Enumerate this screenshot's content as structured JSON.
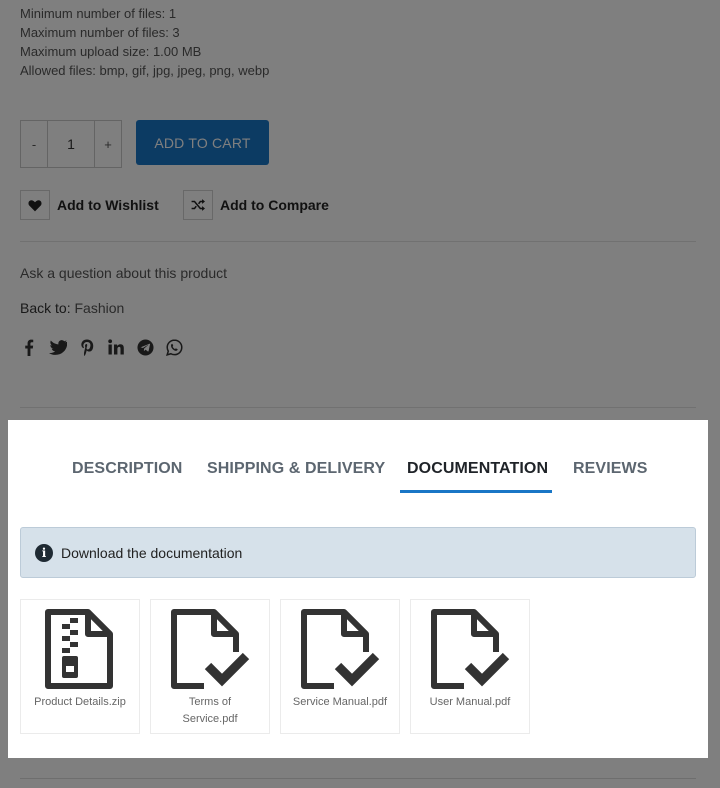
{
  "upload": {
    "min_files": "Minimum number of files: 1",
    "max_files": "Maximum number of files: 3",
    "max_size": "Maximum upload size: 1.00 MB",
    "allowed": "Allowed files: bmp, gif, jpg, jpeg, png, webp"
  },
  "quantity": {
    "minus": "-",
    "value": "1",
    "plus": "+"
  },
  "cart": {
    "add_label": "ADD TO CART"
  },
  "actions": {
    "wishlist": "Add to Wishlist",
    "compare": "Add to Compare"
  },
  "ask_question": "Ask a question about this product",
  "back": {
    "prefix": "Back to:",
    "link": "Fashion"
  },
  "social_icons": [
    "facebook-icon",
    "twitter-icon",
    "pinterest-icon",
    "linkedin-icon",
    "telegram-icon",
    "whatsapp-icon"
  ],
  "tabs": [
    {
      "label": "DESCRIPTION",
      "active": false
    },
    {
      "label": "SHIPPING & DELIVERY",
      "active": false
    },
    {
      "label": "DOCUMENTATION",
      "active": true
    },
    {
      "label": "REVIEWS",
      "active": false
    }
  ],
  "alert": {
    "text": "Download the documentation",
    "icon": "info-icon"
  },
  "files": [
    {
      "name": "Product Details.zip",
      "icon": "zip-file-icon"
    },
    {
      "name": "Terms of Service.pdf",
      "icon": "checked-file-icon"
    },
    {
      "name": "Service Manual.pdf",
      "icon": "checked-file-icon"
    },
    {
      "name": "User Manual.pdf",
      "icon": "checked-file-icon"
    }
  ],
  "colors": {
    "accent": "#1976c6",
    "overlay": "rgba(0,0,0,0.5)",
    "alert_bg": "#d6e1ea"
  }
}
